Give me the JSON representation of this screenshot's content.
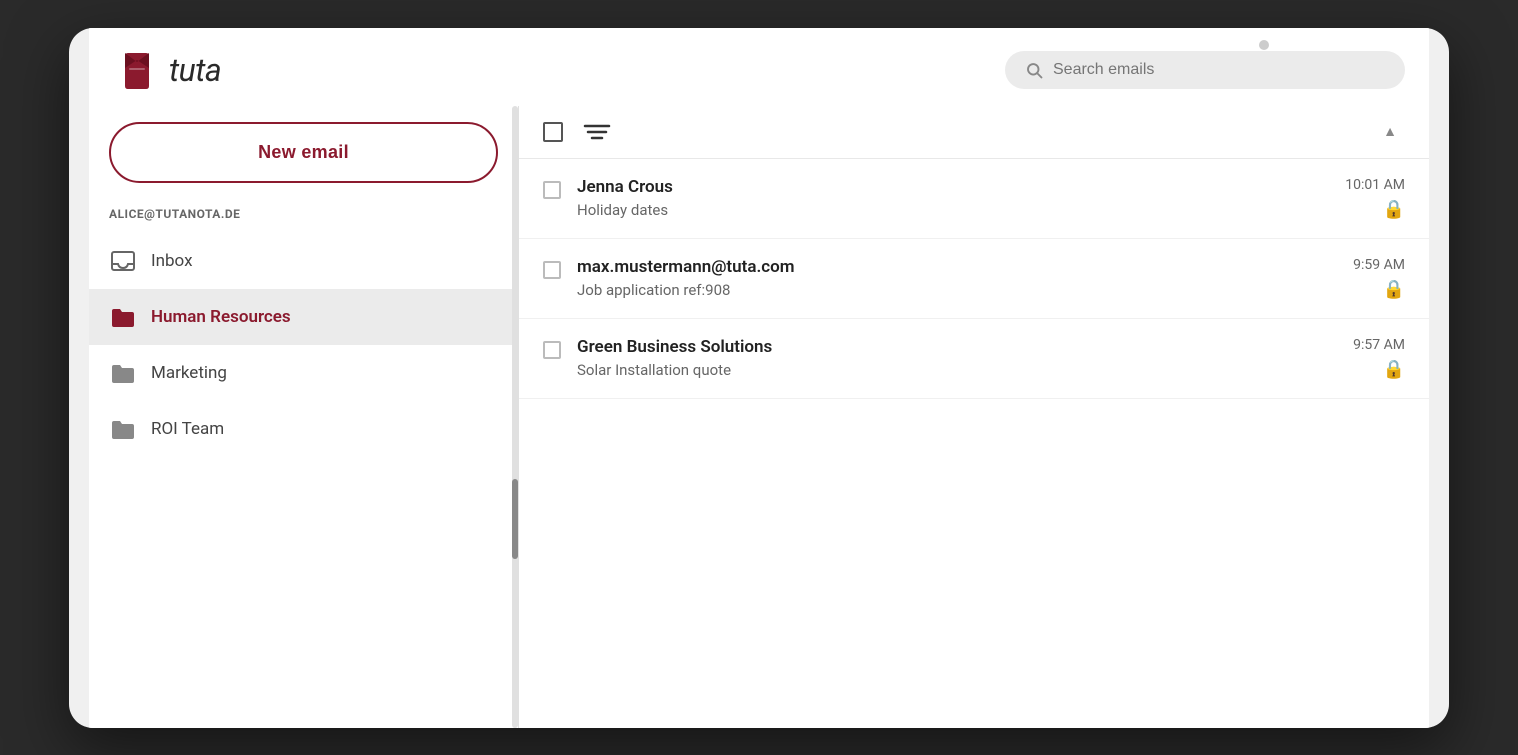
{
  "logo": {
    "text": "tuta"
  },
  "header": {
    "search_placeholder": "Search emails"
  },
  "account": {
    "email": "ALICE@TUTANOTA.DE"
  },
  "sidebar": {
    "new_email_label": "New email",
    "nav_items": [
      {
        "id": "inbox",
        "label": "Inbox",
        "active": false
      },
      {
        "id": "human-resources",
        "label": "Human Resources",
        "active": true
      },
      {
        "id": "marketing",
        "label": "Marketing",
        "active": false
      },
      {
        "id": "roi-team",
        "label": "ROI Team",
        "active": false
      }
    ]
  },
  "email_list": {
    "emails": [
      {
        "sender": "Jenna Crous",
        "subject": "Holiday dates",
        "time": "10:01 AM",
        "encrypted": true
      },
      {
        "sender": "max.mustermann@tuta.com",
        "subject": "Job application ref:908",
        "time": "9:59 AM",
        "encrypted": true
      },
      {
        "sender": "Green Business Solutions",
        "subject": "Solar Installation quote",
        "time": "9:57 AM",
        "encrypted": true
      }
    ]
  },
  "colors": {
    "brand": "#8b1a2e",
    "active_bg": "#ebebeb"
  }
}
